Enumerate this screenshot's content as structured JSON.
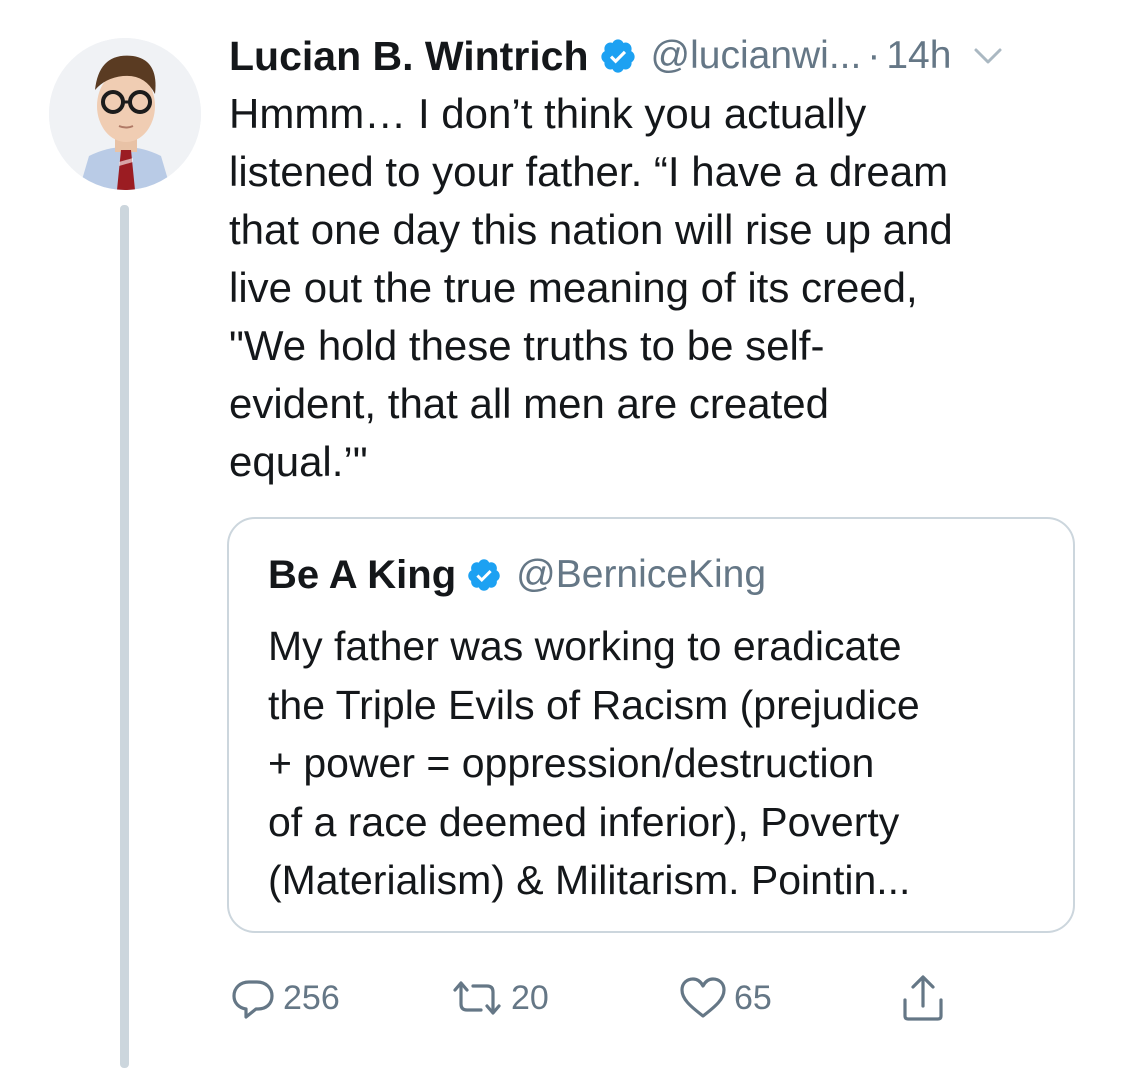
{
  "tweet": {
    "author_name": "Lucian B. Wintrich",
    "handle": "@lucianwi...",
    "separator": "·",
    "time": "14h",
    "text": "Hmmm… I don’t think you actually\nlistened to your father. “I have a dream\nthat one day this nation will rise up and\nlive out the true meaning of its creed,\n\"We hold these truths to be self-\nevident, that all men are created\nequal.’\""
  },
  "quoted_tweet": {
    "author_name": "Be A King",
    "handle": "@BerniceKing",
    "text": "My father was working to eradicate\nthe Triple Evils of Racism (prejudice\n+ power = oppression/destruction\nof a race deemed inferior), Poverty\n(Materialism) & Militarism. Pointin..."
  },
  "actions": {
    "reply_count": "256",
    "retweet_count": "20",
    "like_count": "65"
  },
  "icons": {
    "verified": "verified-badge-icon",
    "menu": "chevron-down-icon",
    "reply": "reply-bubble-icon",
    "retweet": "retweet-icon",
    "like": "heart-icon",
    "share": "share-icon"
  },
  "colors": {
    "text_primary": "#14171a",
    "text_secondary": "#657786",
    "verified_blue": "#1da1f2",
    "border": "#ccd6dd"
  }
}
